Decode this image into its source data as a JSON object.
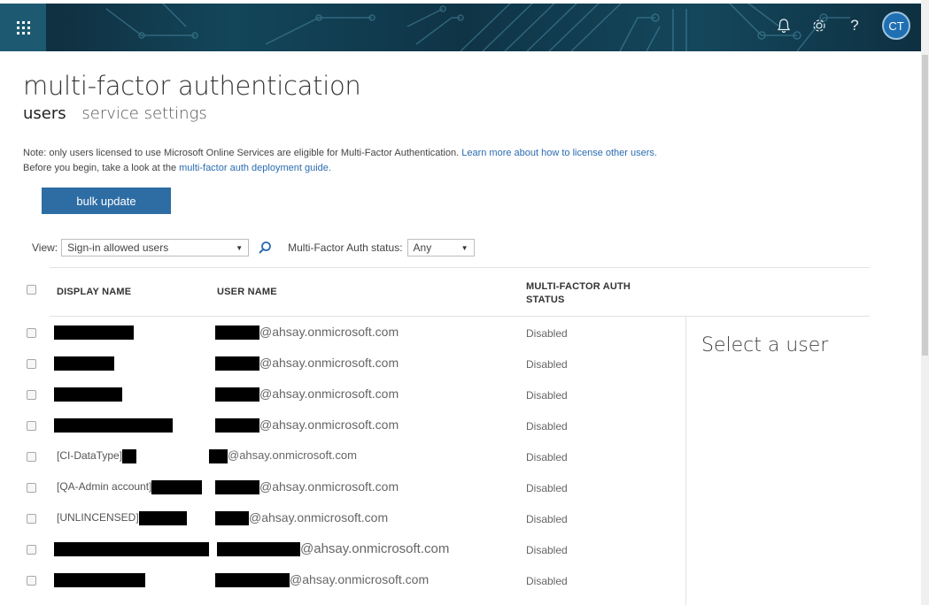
{
  "header": {
    "avatar_initials": "CT",
    "icons": [
      "app-launcher-icon",
      "bell-icon",
      "gear-icon",
      "help-icon"
    ],
    "accent_color": "#2e6da4"
  },
  "page": {
    "title": "multi-factor authentication",
    "tabs": [
      {
        "label": "users",
        "active": true
      },
      {
        "label": "service settings",
        "active": false
      }
    ],
    "note_line1_text": "Note: only users licensed to use Microsoft Online Services are eligible for Multi-Factor Authentication.",
    "note_line1_link": "Learn more about how to license other users.",
    "note_line2_text": "Before you begin, take a look at the",
    "note_line2_link": "multi-factor auth deployment guide.",
    "bulk_update_label": "bulk update"
  },
  "filters": {
    "view_label": "View:",
    "view_value": "Sign-in allowed users",
    "status_label": "Multi-Factor Auth status:",
    "status_value": "Any"
  },
  "table": {
    "headers": {
      "display_name": "DISPLAY NAME",
      "user_name": "USER NAME",
      "mfa_status_1": "MULTI-FACTOR AUTH",
      "mfa_status_2": "STATUS"
    },
    "rows": [
      {
        "display_prefix": "",
        "user_suffix": "@ahsay.onmicrosoft.com",
        "status": "Disabled"
      },
      {
        "display_prefix": "",
        "user_suffix": "@ahsay.onmicrosoft.com",
        "status": "Disabled"
      },
      {
        "display_prefix": "",
        "user_suffix": "@ahsay.onmicrosoft.com",
        "status": "Disabled"
      },
      {
        "display_prefix": "",
        "user_suffix": "@ahsay.onmicrosoft.com",
        "status": "Disabled"
      },
      {
        "display_prefix": "[CI-DataType]",
        "user_suffix": "@ahsay.onmicrosoft.com",
        "status": "Disabled"
      },
      {
        "display_prefix": "[QA-Admin account]",
        "user_suffix": "@ahsay.onmicrosoft.com",
        "status": "Disabled"
      },
      {
        "display_prefix": "[UNLINCENSED]",
        "user_suffix": "@ahsay.onmicrosoft.com",
        "status": "Disabled"
      },
      {
        "display_prefix": "",
        "user_suffix": "@ahsay.onmicrosoft.com",
        "status": "Disabled"
      },
      {
        "display_prefix": "",
        "user_suffix": "@ahsay.onmicrosoft.com",
        "status": "Disabled"
      }
    ]
  },
  "detail_panel": {
    "placeholder": "Select a user"
  }
}
